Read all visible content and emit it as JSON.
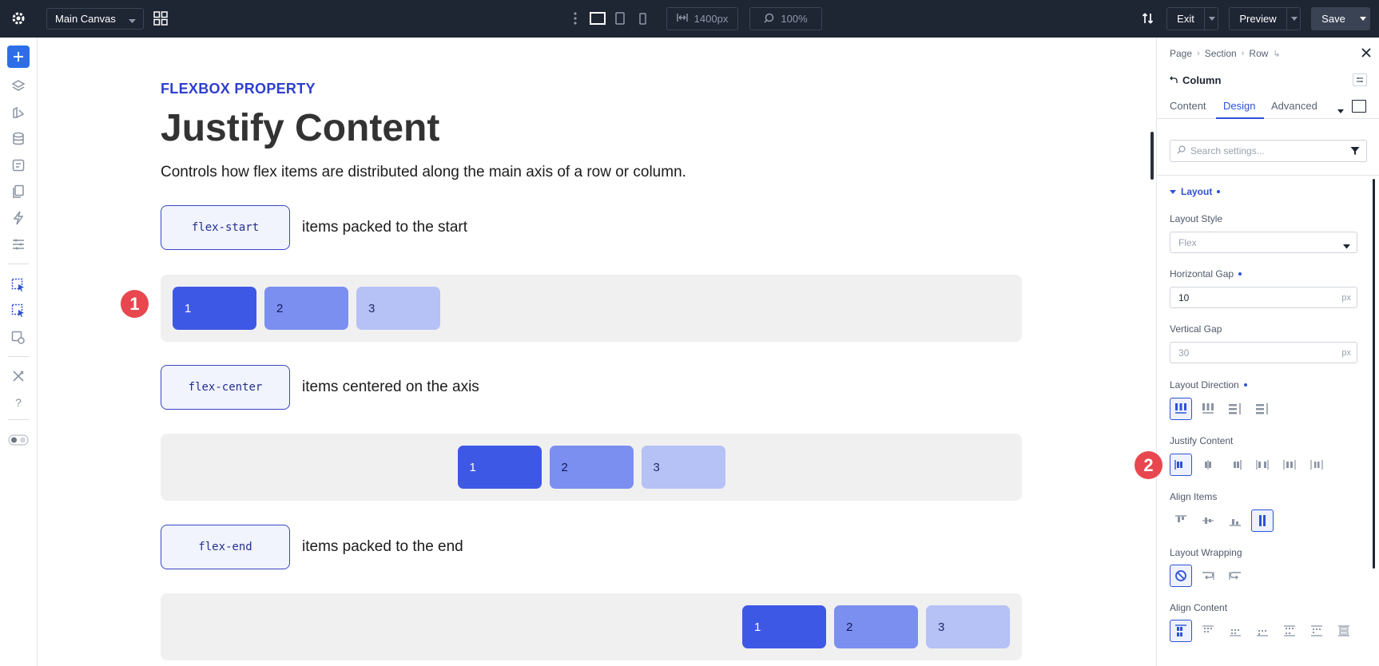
{
  "topbar": {
    "canvas_select": "Main Canvas",
    "width_value": "1400px",
    "zoom_value": "100%",
    "exit_label": "Exit",
    "preview_label": "Preview",
    "save_label": "Save"
  },
  "canvas": {
    "eyebrow": "FLEXBOX PROPERTY",
    "title": "Justify Content",
    "description": "Controls how flex items are distributed along the main axis of a row or column.",
    "examples": [
      {
        "code": "flex-start",
        "caption": "items packed to the start"
      },
      {
        "code": "flex-center",
        "caption": "items centered on the axis"
      },
      {
        "code": "flex-end",
        "caption": "items packed to the end"
      }
    ],
    "items": [
      "1",
      "2",
      "3"
    ],
    "markers": [
      "1",
      "2"
    ]
  },
  "panel": {
    "breadcrumb": [
      "Page",
      "Section",
      "Row"
    ],
    "element_title": "Column",
    "tabs": [
      "Content",
      "Design",
      "Advanced"
    ],
    "active_tab": "Design",
    "search_placeholder": "Search settings...",
    "section": "Layout",
    "layout_style_label": "Layout Style",
    "layout_style_value": "Flex",
    "horizontal_gap_label": "Horizontal Gap",
    "horizontal_gap_value": "10",
    "vertical_gap_label": "Vertical Gap",
    "vertical_gap_value": "30",
    "unit": "px",
    "layout_direction_label": "Layout Direction",
    "justify_content_label": "Justify Content",
    "align_items_label": "Align Items",
    "layout_wrapping_label": "Layout Wrapping",
    "align_content_label": "Align Content"
  },
  "colors": {
    "accent": "#2d52d6",
    "topbar": "#1e2533",
    "item_1": "#3e58e6",
    "item_2": "#7b8ff0",
    "item_3": "#b6c1f6",
    "marker": "#e8474f"
  }
}
